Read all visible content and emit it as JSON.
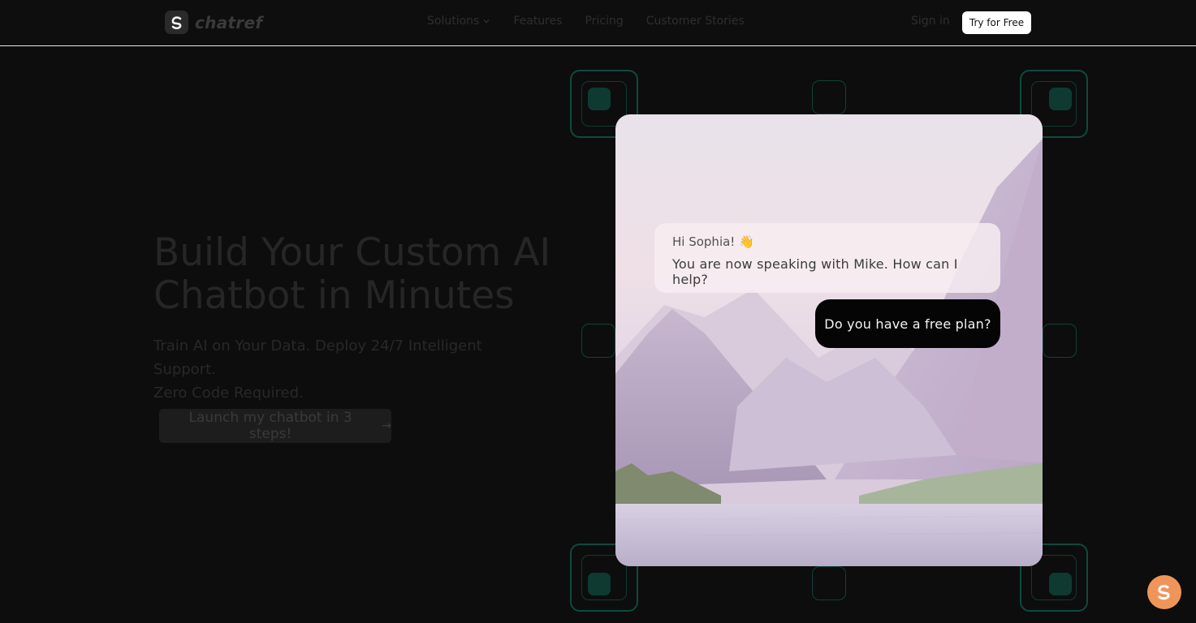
{
  "nav": {
    "brand": "chatref",
    "links": [
      "Solutions",
      "Features",
      "Pricing",
      "Customer Stories"
    ],
    "sign_in": "Sign in",
    "cta": "Try for Free"
  },
  "hero": {
    "title_line1": "Build Your Custom AI",
    "title_line2": "Chatbot in Minutes",
    "subtitle_line1": "Train AI on Your Data. Deploy 24/7 Intelligent Support.",
    "subtitle_line2": "Zero Code Required.",
    "cta_label": "Launch my chatbot in 3 steps!",
    "cta_arrow": "→"
  },
  "chat": {
    "greeting": "Hi Sophia! 👋",
    "bot_message": "You are now speaking with Mike. How can I help?",
    "user_message": "Do you have a free plan?"
  },
  "colors": {
    "background": "#0d0d0d",
    "accent_teal": "#0f4a3e",
    "fab": "#f0955a"
  }
}
